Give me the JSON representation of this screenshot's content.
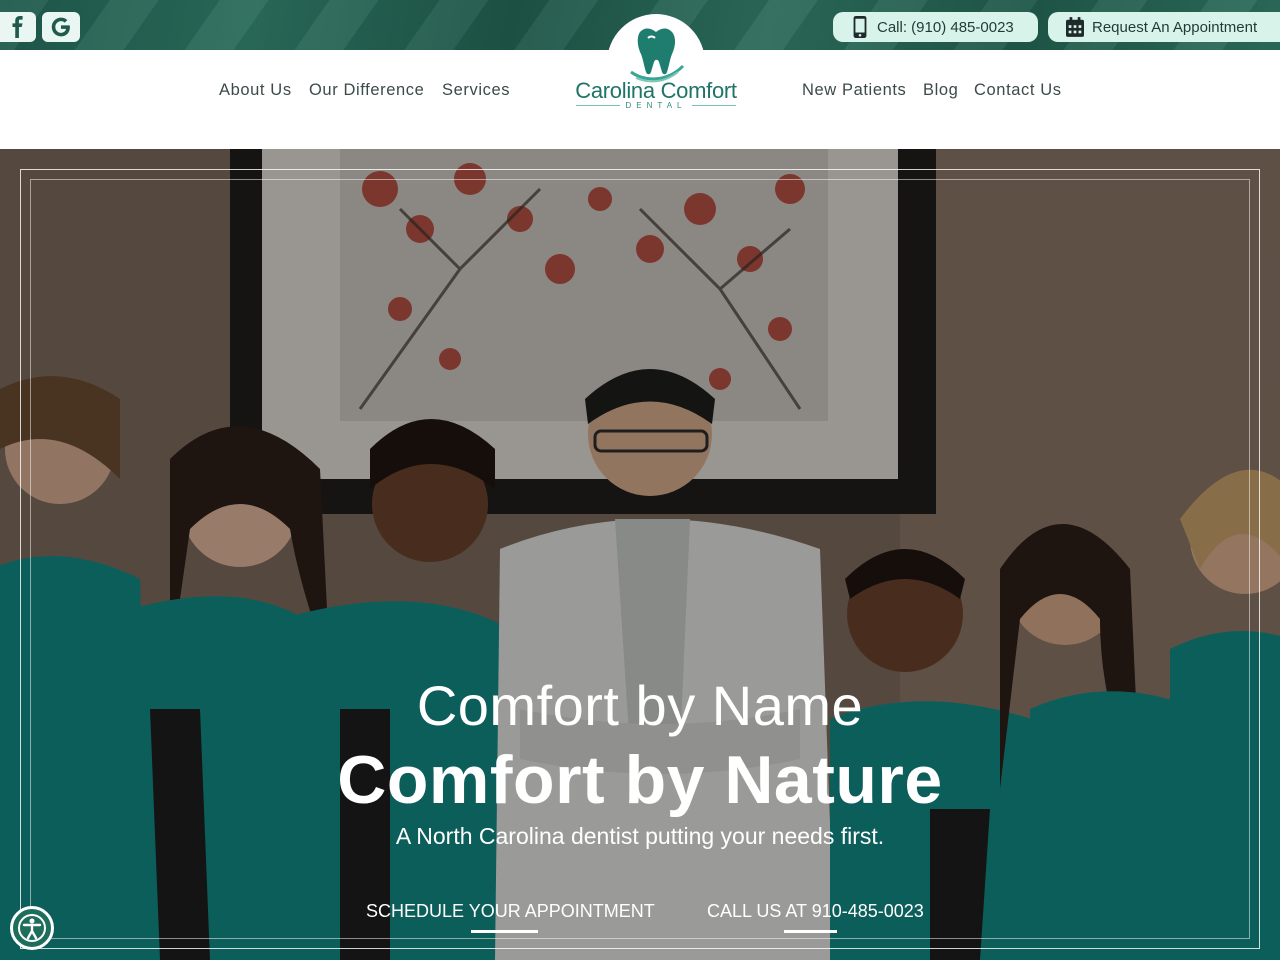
{
  "topbar": {
    "social": [
      {
        "name": "facebook",
        "icon": "facebook-icon"
      },
      {
        "name": "google",
        "icon": "google-icon"
      }
    ],
    "call_label": "Call: (910) 485-0023",
    "appointment_label": "Request An Appointment"
  },
  "nav": {
    "left": [
      "About Us",
      "Our Difference",
      "Services"
    ],
    "right": [
      "New Patients",
      "Blog",
      "Contact Us"
    ]
  },
  "logo": {
    "name": "Carolina Comfort",
    "sub": "DENTAL",
    "color": "#1f7468"
  },
  "hero": {
    "line1": "Comfort by Name",
    "line2": "Comfort by Nature",
    "line3": "A North Carolina dentist putting your needs first.",
    "cta_schedule": "SCHEDULE YOUR APPOINTMENT",
    "cta_call": "CALL US AT 910-485-0023"
  },
  "colors": {
    "brand_green": "#1f5a4c",
    "pill_bg": "#d8f3ea",
    "scrub_teal": "#0f8a86"
  },
  "accessibility": {
    "icon": "accessibility-icon"
  }
}
